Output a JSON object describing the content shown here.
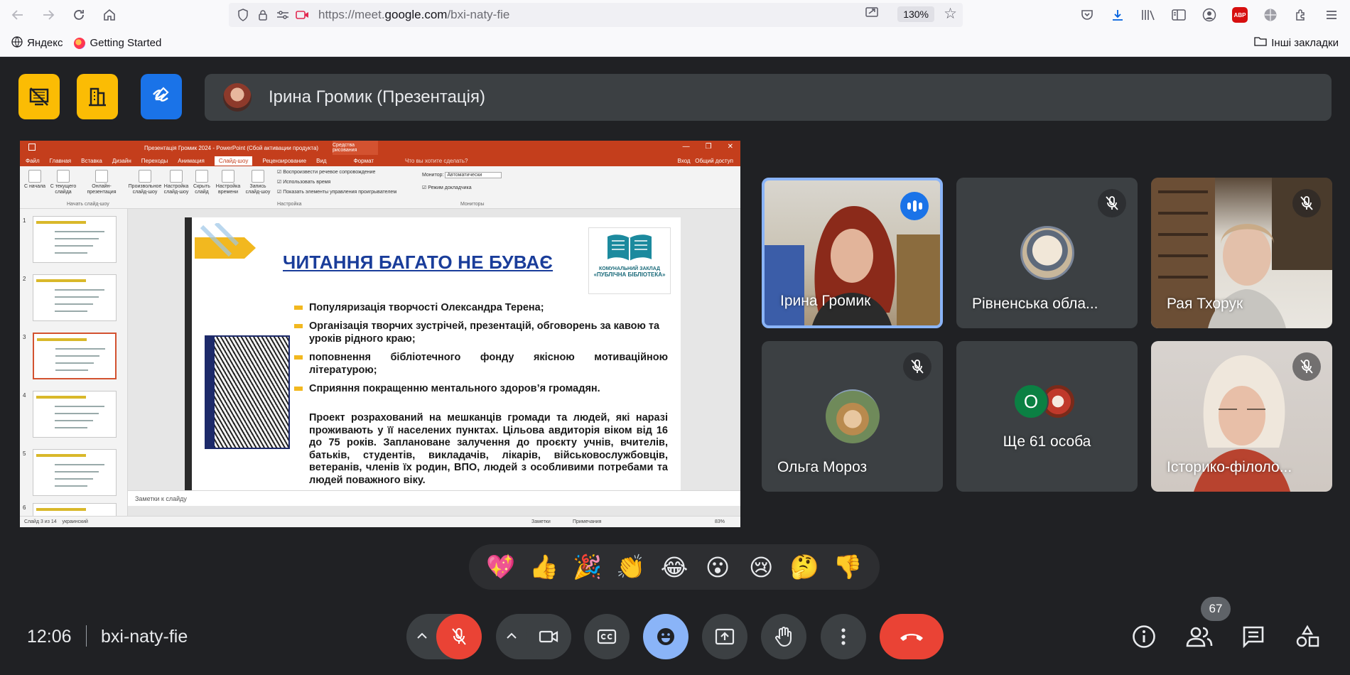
{
  "browser": {
    "url_prefix": "https://meet.",
    "url_domain": "google.com",
    "url_path": "/bxi-naty-fie",
    "zoom": "130%",
    "bookmarks": [
      {
        "label": "Яндекс"
      },
      {
        "label": "Getting Started"
      }
    ],
    "other_bookmarks": "Інші закладки"
  },
  "presenter_banner": {
    "name": "Ірина Громик (Презентація)"
  },
  "powerpoint": {
    "title": "Презентація Громик 2024 - PowerPoint (Сбой активации продукта)",
    "context_tab": "Средства рисования",
    "tabs": [
      "Файл",
      "Главная",
      "Вставка",
      "Дизайн",
      "Переходы",
      "Анимация",
      "Слайд-шоу",
      "Рецензирование",
      "Вид",
      "Формат"
    ],
    "active_tab": "Слайд-шоу",
    "search_hint": "Что вы хотите сделать?",
    "login": "Вход",
    "share": "Общий доступ",
    "ribbon": {
      "buttons": [
        "С начала",
        "С текущего слайда",
        "Онлайн-презентация",
        "Произвольное слайд-шоу",
        "Настройка слайд-шоу",
        "Скрыть слайд",
        "Настройка времени",
        "Запись слайд-шоу"
      ],
      "checks": [
        "Воспроизвести речевое сопровождение",
        "Использовать время",
        "Показать элементы управления проигрывателем",
        "Режим докладчика"
      ],
      "monitor_label": "Монитор:",
      "monitor_value": "Автоматически",
      "groups": [
        "Начать слайд-шоу",
        "Настройка",
        "Мониторы"
      ]
    },
    "thumbs": [
      {
        "num": "1"
      },
      {
        "num": "2"
      },
      {
        "num": "3"
      },
      {
        "num": "4"
      },
      {
        "num": "5"
      },
      {
        "num": "6"
      }
    ],
    "slide": {
      "title": "ЧИТАННЯ БАГАТО НЕ БУВАЄ",
      "logo_line1": "КОМУНАЛЬНИЙ ЗАКЛАД",
      "logo_line2": "«ПУБЛІЧНА БІБЛІОТЕКА»",
      "bullets": [
        "Популяризація творчості Олександра Терена;",
        "Організація творчих зустрічей, презентацій, обговорень за кавою та уроків рідного краю;",
        "поповнення бібліотечного фонду якісною мотиваційною літературою;",
        "Сприяння покращенню ментального здоров’я громадян."
      ],
      "paragraph": "Проект розрахований на мешканців громади та людей, які наразі проживають у її населених пунктах. Цільова авдиторія віком від 16 до 75 років. Заплановане залучення до проєкту учнів, вчителів, батьків, студентів, викладачів, лікарів, військовослужбовців, ветеранів, членів їх родин, ВПО, людей з особливими потребами та людей поважного віку."
    },
    "notes_placeholder": "Заметки к слайду",
    "status_left": "Слайд 3 из 14",
    "status_lang": "украинский",
    "status_notes": "Заметки",
    "status_comments": "Примечания",
    "zoom": "83%"
  },
  "participants": [
    {
      "name": "Ірина Громик",
      "speaking": true
    },
    {
      "name": "Рівненська обла...",
      "speaking": false
    },
    {
      "name": "Рая Тхорук",
      "speaking": false
    },
    {
      "name": "Ольга Мороз",
      "speaking": false
    },
    {
      "name": "Ще 61 особа",
      "initial": "О",
      "speaking": false
    },
    {
      "name": "Історико-філоло...",
      "speaking": false
    }
  ],
  "reactions": [
    "💖",
    "👍",
    "🎉",
    "👏",
    "😂",
    "😮",
    "😢",
    "🤔",
    "👎"
  ],
  "bottom_bar": {
    "time": "12:06",
    "meeting_code": "bxi-naty-fie",
    "people_count": "67"
  },
  "colors": {
    "meet_bg": "#202124",
    "tile_bg": "#3c4043",
    "hangup_red": "#ea4335",
    "active_blue": "#8ab4f8",
    "yellow_tile": "#fbbc04",
    "blue_tile": "#1a73e8",
    "ppt_red": "#c43e1c"
  }
}
